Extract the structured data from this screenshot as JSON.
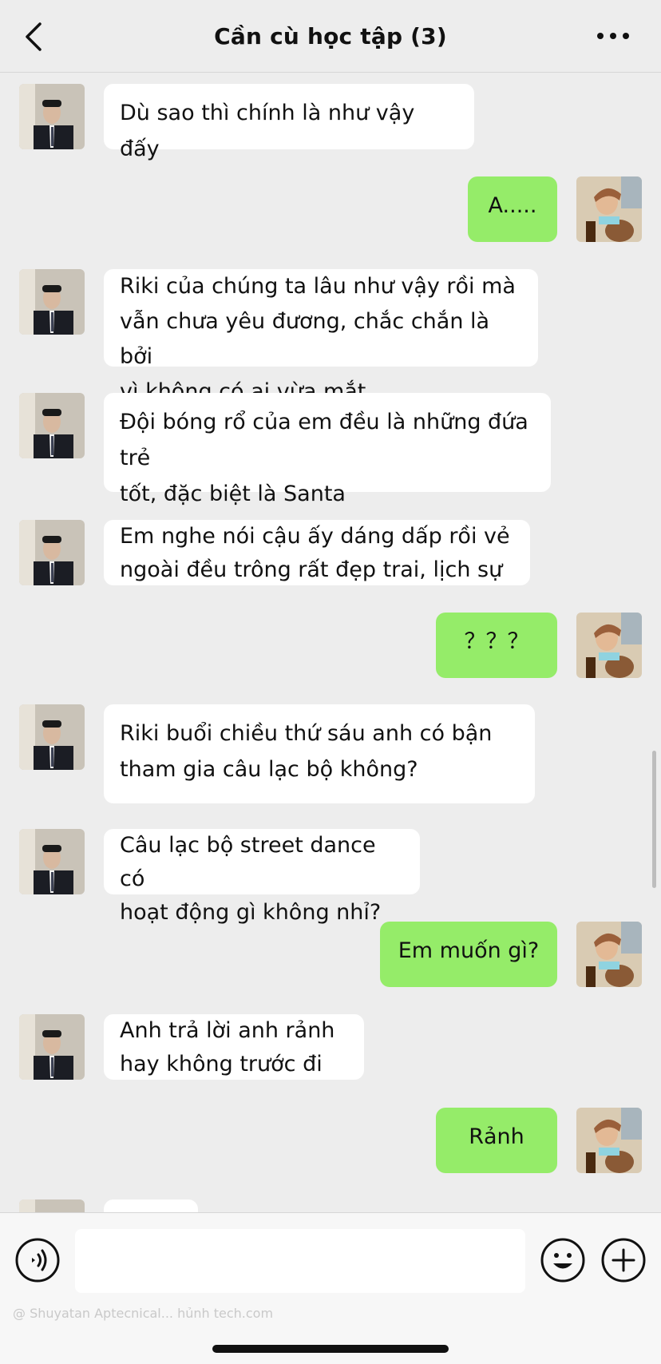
{
  "header": {
    "title": "Cần cù học tập (3)"
  },
  "messages": [
    {
      "side": "left",
      "text": "Dù sao thì chính là như vậy đấy"
    },
    {
      "side": "right",
      "text": "A....."
    },
    {
      "side": "left",
      "text": "Riki của chúng ta lâu như vậy rồi mà\nvẫn chưa yêu đương, chắc chắn là bởi\nvì không có ai vừa mắt"
    },
    {
      "side": "left",
      "text": "Đội bóng rổ của em đều là những đứa trẻ\ntốt, đặc biệt là Santa"
    },
    {
      "side": "left",
      "text": "Em nghe nói cậu ấy dáng dấp rồi vẻ\nngoài đều trông rất đẹp trai, lịch sự"
    },
    {
      "side": "right",
      "text": "？？？"
    },
    {
      "side": "left",
      "text": "Riki buổi chiều thứ sáu anh có bận\ntham gia câu lạc bộ không?"
    },
    {
      "side": "left",
      "text": "Câu lạc bộ street dance có\nhoạt động gì không nhỉ?"
    },
    {
      "side": "right",
      "text": "Em muốn gì?"
    },
    {
      "side": "left",
      "text": "Anh trả lời anh rảnh\nhay không trước đi"
    },
    {
      "side": "right",
      "text": "Rảnh"
    },
    {
      "side": "left",
      "text": ""
    }
  ],
  "input": {
    "value": "",
    "placeholder": ""
  },
  "watermark": "@ Shuyatan Aptecnical... hủnh tech.com",
  "icons": {
    "back": "chevron-left-icon",
    "more": "ellipsis-icon",
    "voice": "voice-icon",
    "emoji": "smiley-icon",
    "plus": "plus-icon"
  },
  "colors": {
    "background": "#ededed",
    "bubble_self": "#95ec69",
    "bubble_other": "#ffffff"
  }
}
